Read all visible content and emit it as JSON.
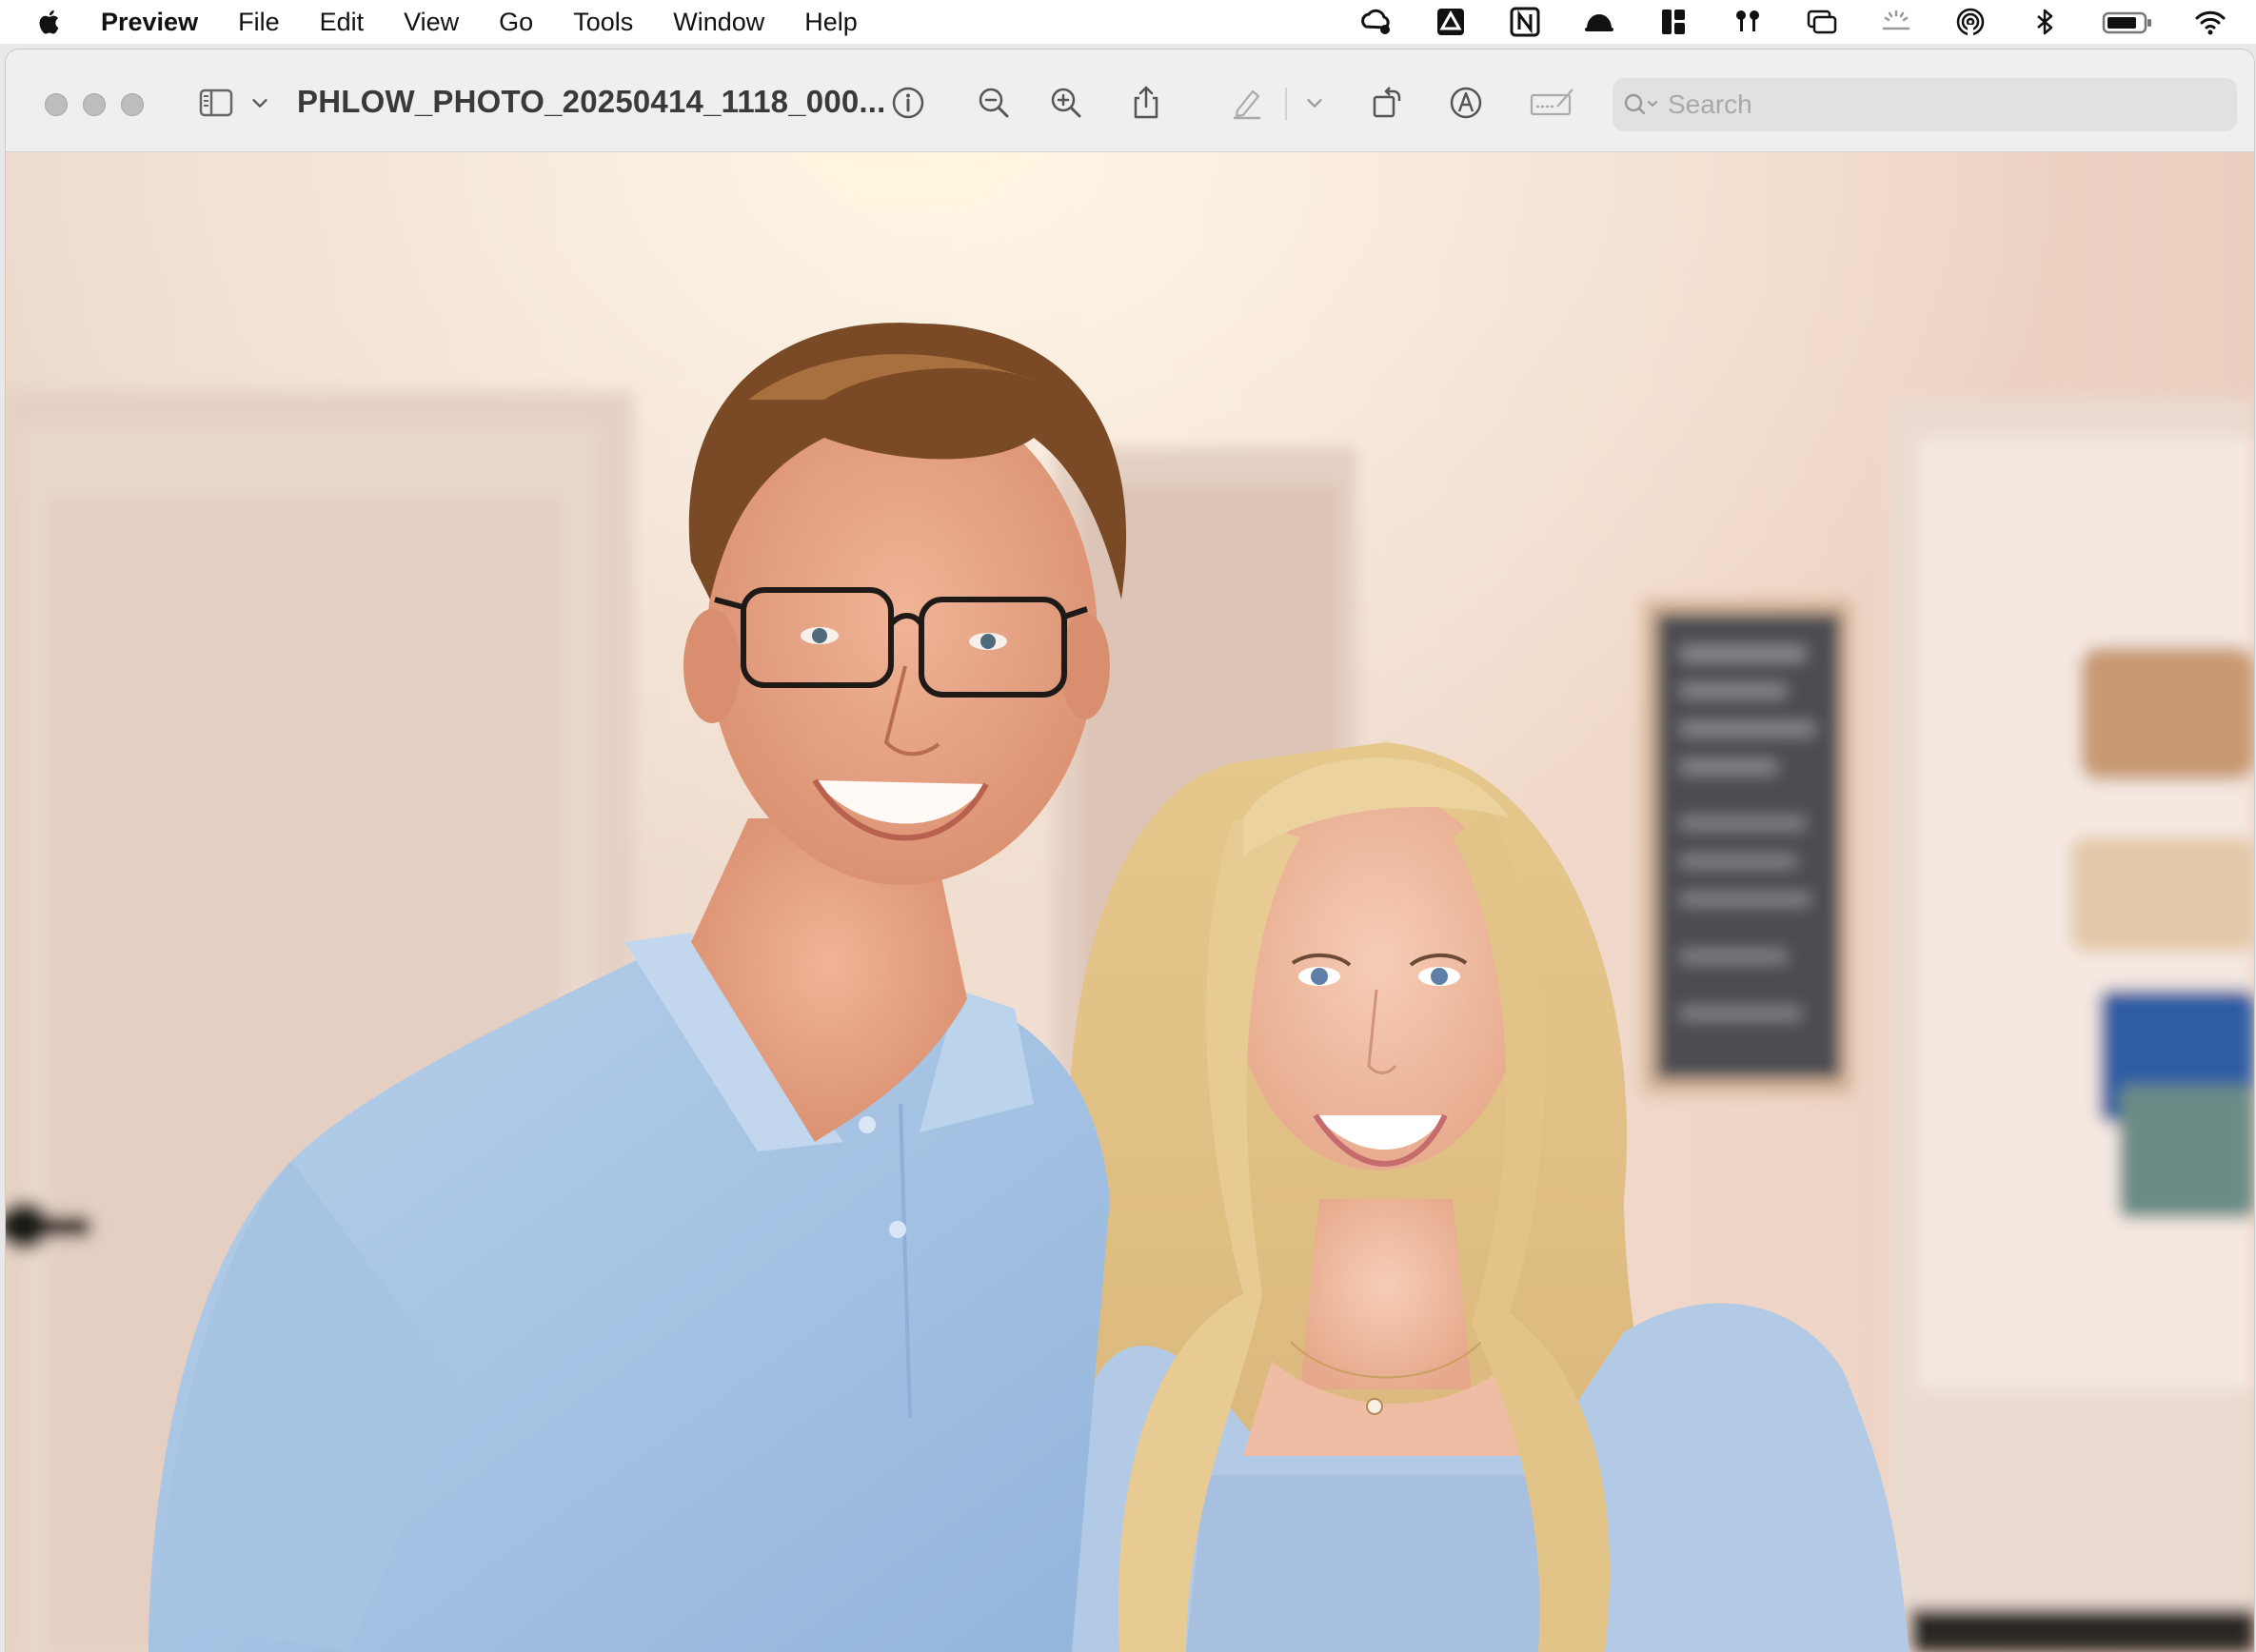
{
  "menubar": {
    "app_name": "Preview",
    "items": [
      "File",
      "Edit",
      "View",
      "Go",
      "Tools",
      "Window",
      "Help"
    ],
    "status_icons": [
      "creative-cloud-icon",
      "google-drive-icon",
      "notion-icon",
      "bartender-icon",
      "layout-icon",
      "airpods-icon",
      "screen-mirroring-icon",
      "brightness-icon",
      "airdrop-icon",
      "bluetooth-icon",
      "battery-icon",
      "wifi-icon"
    ]
  },
  "toolbar": {
    "document_title": "PHLOW_PHOTO_20250414_1118_000...",
    "search_placeholder": "Search",
    "icons": [
      "sidebar-icon",
      "chevron-down-icon",
      "info-icon",
      "zoom-out-icon",
      "zoom-in-icon",
      "share-icon",
      "highlight-pen-icon",
      "chevron-down-icon",
      "rotate-icon",
      "markup-icon",
      "sign-icon",
      "search-icon"
    ]
  },
  "photo": {
    "description_tags": [
      "portrait-photo"
    ],
    "palette": {
      "wall": "#efdcd0",
      "door": "#e7d6cc",
      "shirt": "#a9c7e6",
      "hair_man": "#7a4a26",
      "hair_woman": "#e8c98c",
      "skin": "#e9a98a"
    }
  }
}
